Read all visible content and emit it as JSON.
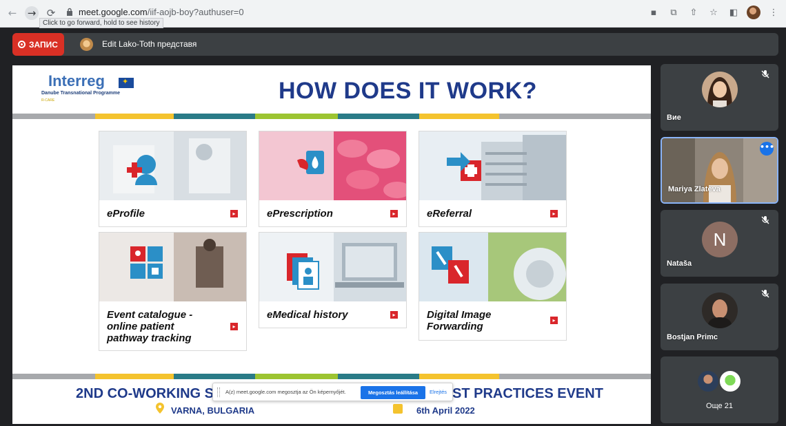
{
  "browser": {
    "url_host": "meet.google.com",
    "url_path": "/iif-aojb-boy?authuser=0",
    "tooltip": "Click to go forward, hold to see history"
  },
  "meet": {
    "record_label": "ЗАПИС",
    "presenter_text": "Edit Lako-Toth представя"
  },
  "slide": {
    "logo_word": "Interreg",
    "logo_sub": "Danube Transnational Programme",
    "logo_tiny": "R-CARE",
    "title": "HOW DOES IT WORK?",
    "cards": [
      {
        "label": "eProfile"
      },
      {
        "label": "ePrescription"
      },
      {
        "label": "eReferral"
      },
      {
        "label": "Event catalogue -\nonline patient\npathway tracking"
      },
      {
        "label": "eMedical history"
      },
      {
        "label": "Digital Image\nForwarding"
      }
    ],
    "footer_left": "2ND CO-WORKING S",
    "footer_right": "ST PRACTICES EVENT",
    "venue": "VARNA, BULGARIA",
    "date": "6th April 2022"
  },
  "share_bar": {
    "message": "A(z) meet.google.com megosztja az Ön képernyőjét.",
    "stop": "Megosztás leállítása",
    "hide": "Elrejtés"
  },
  "participants": [
    {
      "name": "Вие",
      "muted": true
    },
    {
      "name": "Mariya Zlateva",
      "active": true
    },
    {
      "name": "Nataša",
      "initial": "N",
      "muted": true
    },
    {
      "name": "Bostjan Primc",
      "muted": true
    },
    {
      "others": "Още 21"
    }
  ],
  "colors": {
    "record": "#d93025",
    "accent": "#1a73e8",
    "slide_title": "#1f3a8a",
    "tile_bg": "#3c4043"
  }
}
